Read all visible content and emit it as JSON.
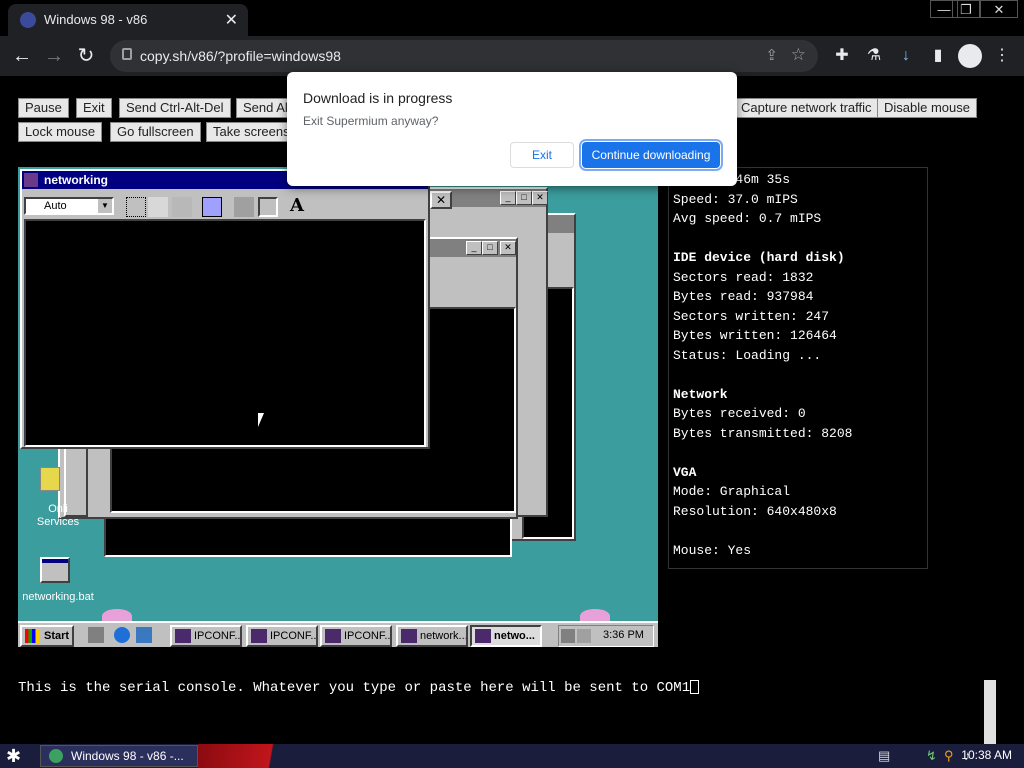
{
  "browser": {
    "tab_title": "Windows 98 - v86",
    "tab_close": "✕",
    "url": "copy.sh/v86/?profile=windows98",
    "window_controls": [
      "—",
      "❐",
      "✕"
    ]
  },
  "controls": {
    "row1": [
      "Pause",
      "Exit",
      "Send Ctrl-Alt-Del",
      "Send Al",
      "Capture network traffic",
      "Disable mouse"
    ],
    "row2": [
      "Lock mouse",
      "Go fullscreen",
      "Take screens"
    ]
  },
  "dialog": {
    "title": "Download is in progress",
    "subtitle": "Exit Supermium anyway?",
    "exit_label": "Exit",
    "continue_label": "Continue downloading"
  },
  "emulator": {
    "main_window_title": "networking",
    "font_select": "Auto",
    "desktop_icons": [
      {
        "label": "Online Services",
        "label1": "Onli",
        "label2": "Services"
      },
      {
        "label": "networking.bat"
      }
    ],
    "taskbar": {
      "start": "Start",
      "tasks": [
        "IPCONF...",
        "IPCONF...",
        "IPCONF...",
        "network...",
        "netwo..."
      ],
      "clock": "3:36 PM"
    }
  },
  "stats": [
    {
      "text": "Uptime: 46m 35s",
      "bold": false
    },
    {
      "text": "Speed: 37.0 mIPS",
      "bold": false
    },
    {
      "text": "Avg speed: 0.7 mIPS",
      "bold": false
    },
    {
      "text": "",
      "bold": false
    },
    {
      "text": "IDE device (hard disk)",
      "bold": true
    },
    {
      "text": "Sectors read: 1832",
      "bold": false
    },
    {
      "text": "Bytes read: 937984",
      "bold": false
    },
    {
      "text": "Sectors written: 247",
      "bold": false
    },
    {
      "text": "Bytes written: 126464",
      "bold": false
    },
    {
      "text": "Status: Loading ...",
      "bold": false
    },
    {
      "text": "",
      "bold": false
    },
    {
      "text": "Network",
      "bold": true
    },
    {
      "text": "Bytes received: 0",
      "bold": false
    },
    {
      "text": "Bytes transmitted: 8208",
      "bold": false
    },
    {
      "text": "",
      "bold": false
    },
    {
      "text": "VGA",
      "bold": true
    },
    {
      "text": "Mode: Graphical",
      "bold": false
    },
    {
      "text": "Resolution: 640x480x8",
      "bold": false
    },
    {
      "text": "",
      "bold": false
    },
    {
      "text": "Mouse: Yes",
      "bold": false
    }
  ],
  "console": {
    "text": "This is the serial console. Whatever you type or paste here will be sent to COM1"
  },
  "os_taskbar": {
    "task": "Windows 98 - v86 -...",
    "clock": "10:38 AM"
  }
}
